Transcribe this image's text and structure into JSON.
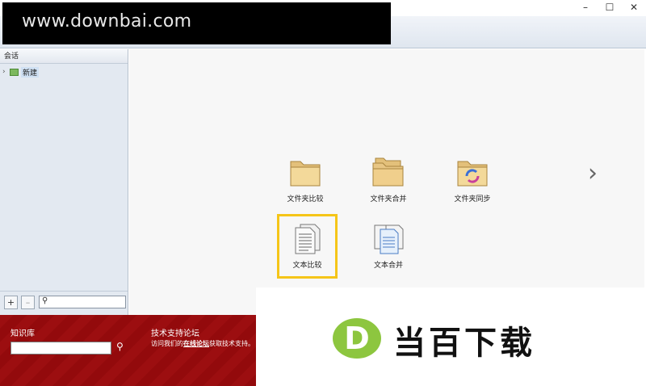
{
  "window": {
    "controls": {
      "minimize": "–",
      "maximize": "☐",
      "close": "✕"
    }
  },
  "watermark": {
    "banner_text": "www.downbai.com",
    "logo_letter": "D",
    "logo_text": "当百下载"
  },
  "sidebar": {
    "header": "会话",
    "tree": [
      {
        "label": "新建",
        "icon": "session-icon",
        "expand_glyph": "›"
      }
    ],
    "add_label": "+",
    "remove_label": "–",
    "search_placeholder": ""
  },
  "main": {
    "tiles": [
      {
        "id": "folder-compare",
        "label": "文件夹比较",
        "icon": "folder-icon"
      },
      {
        "id": "folder-merge",
        "label": "文件夹合并",
        "icon": "folder-merge-icon"
      },
      {
        "id": "folder-sync",
        "label": "文件夹同步",
        "icon": "folder-sync-icon"
      },
      {
        "id": "text-compare",
        "label": "文本比较",
        "icon": "document-icon",
        "selected": true
      },
      {
        "id": "text-merge",
        "label": "文本合并",
        "icon": "document-merge-icon"
      }
    ],
    "next_glyph": "›"
  },
  "footer": {
    "knowledge_base": "知识库",
    "knowledge_input_value": "",
    "forum_title": "技术支持论坛",
    "forum_text_pre": "访问我们的",
    "forum_link": "在线论坛",
    "forum_text_post": "获取技术支持。"
  },
  "colors": {
    "accent_red": "#9c0e10",
    "selection": "#f5c518",
    "logo_green": "#8dc63f"
  }
}
